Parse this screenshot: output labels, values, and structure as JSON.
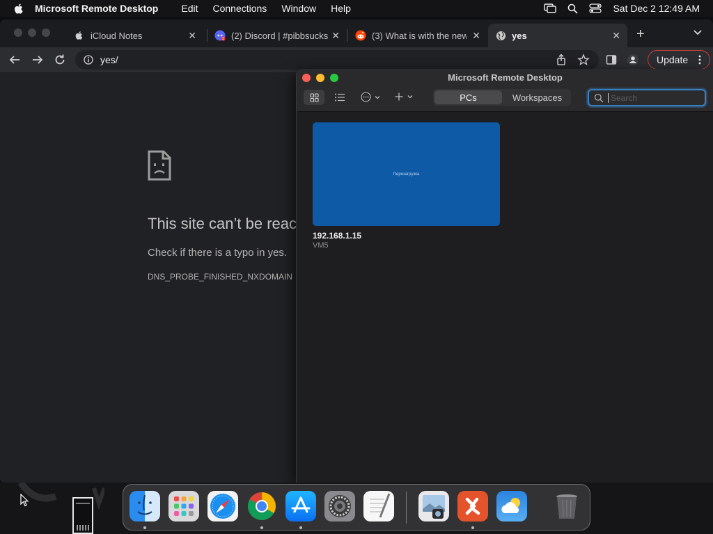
{
  "menubar": {
    "app_name": "Microsoft Remote Desktop",
    "menus": [
      "Edit",
      "Connections",
      "Window",
      "Help"
    ],
    "clock": "Sat Dec 2  12:49 AM"
  },
  "browser": {
    "tabs": [
      {
        "title": "iCloud Notes",
        "icon": "apple-icon"
      },
      {
        "title": "(2) Discord | #pibbsucks",
        "icon": "discord-icon"
      },
      {
        "title": "(3) What is with the new",
        "icon": "reddit-icon"
      },
      {
        "title": "yes",
        "icon": "globe-icon"
      }
    ],
    "url": "yes/",
    "update_label": "Update",
    "error": {
      "title": "This site can’t be reached",
      "subtitle": "Check if there is a typo in yes.",
      "code": "DNS_PROBE_FINISHED_NXDOMAIN"
    }
  },
  "rdp": {
    "window_title": "Microsoft Remote Desktop",
    "segments": [
      "PCs",
      "Workspaces"
    ],
    "search_placeholder": "Search",
    "pcs": [
      {
        "name": "192.168.1.15",
        "sub": "VM5",
        "thumbnail_text": "Перезагрузка"
      }
    ]
  },
  "dock": {
    "apps": [
      "finder",
      "launchpad",
      "safari",
      "chrome",
      "app-store",
      "system-settings",
      "textedit",
      "preview",
      "remote-desktop",
      "weather",
      "trash"
    ]
  },
  "colors": {
    "accent_blue": "#3a7fbf",
    "pc_card": "#0e5aa7",
    "update_border": "#c9413b"
  }
}
